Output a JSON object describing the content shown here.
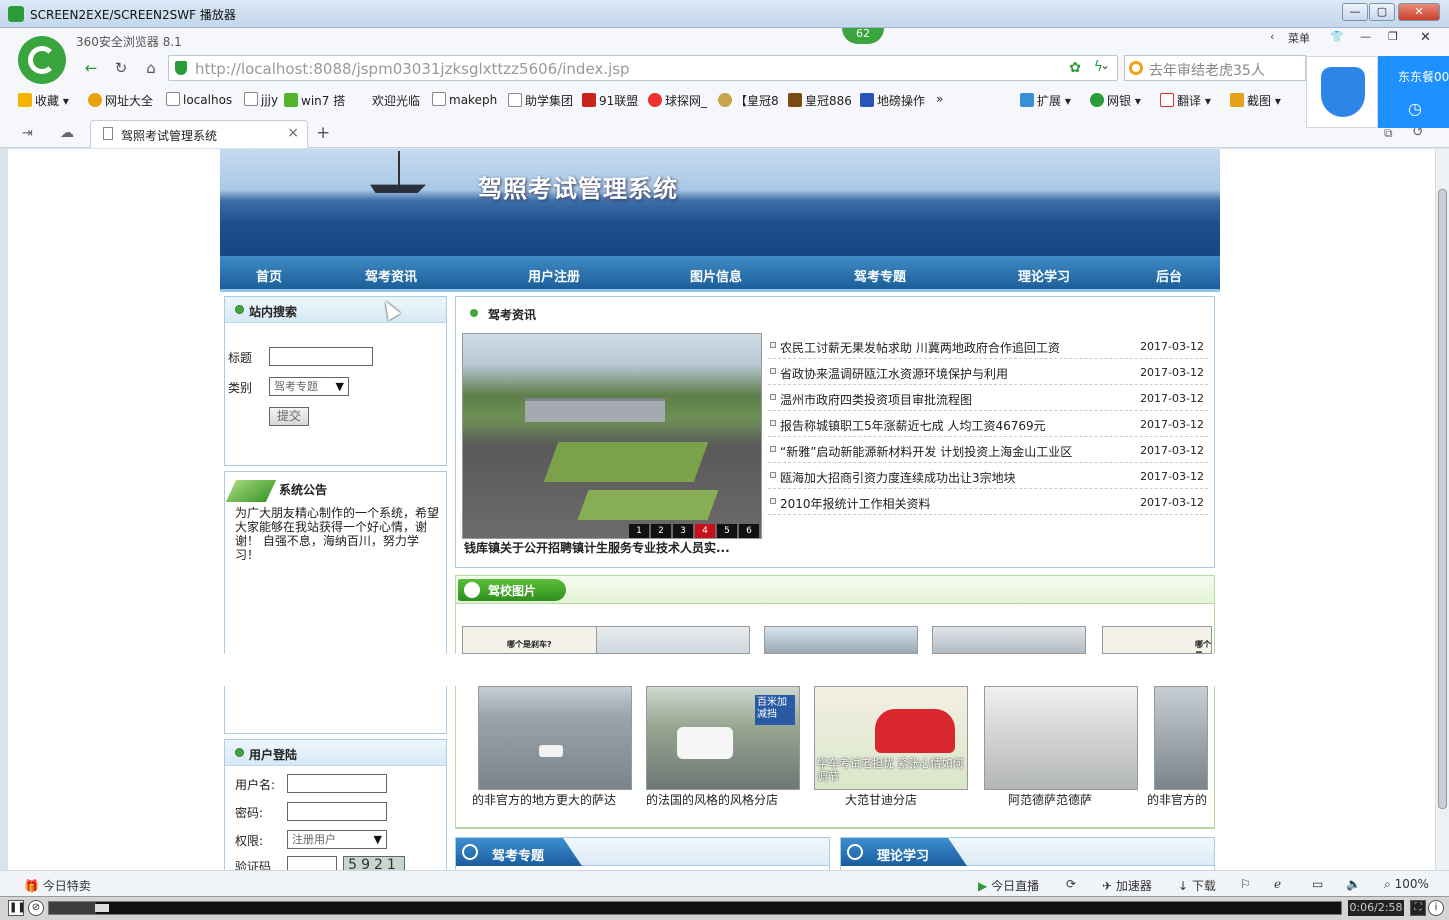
{
  "window": {
    "title": "SCREEN2EXE/SCREEN2SWF 播放器"
  },
  "browser": {
    "brand": "360安全浏览器 8.1",
    "badge": "62",
    "menu_label": "菜单",
    "url_host": "http://localhost",
    "url_rest": ":8088/jspm03031jzksglxttzz5606/index.jsp",
    "search_placeholder": "去年审结老虎35人",
    "bookmarks": [
      "收藏",
      "网址大全",
      "localhos",
      "jjjy",
      "win7 搭",
      "欢迎光临",
      "makeph",
      "助学集团",
      "91联盟",
      "球探网_",
      "【皇冠8",
      "皇冠886",
      "地磅操作"
    ],
    "toolbar_right": [
      "扩展",
      "网银",
      "翻译",
      "截图"
    ],
    "tab_title": "驾照考试管理系统",
    "side_widget_text": "东东餐00"
  },
  "site": {
    "title": "驾照考试管理系统",
    "nav": [
      "首页",
      "驾考资讯",
      "用户注册",
      "图片信息",
      "驾考专题",
      "理论学习",
      "后台"
    ],
    "search": {
      "heading": "站内搜索",
      "title_label": "标题",
      "category_label": "类别",
      "category_value": "驾考专题",
      "submit": "提交"
    },
    "notice": {
      "heading": "系统公告",
      "body": "为广大朋友精心制作的一个系统，希望大家能够在我站获得一个好心情，谢谢！ 自强不息，海纳百川，努力学习！"
    },
    "login": {
      "heading": "用户登陆",
      "username_label": "用户名:",
      "password_label": "密码:",
      "role_label": "权限:",
      "role_value": "注册用户",
      "captcha_label": "验证码",
      "captcha": "5921"
    },
    "news": {
      "heading": "驾考资讯",
      "caption": "钱库镇关于公开招聘镇计生服务专业技术人员实...",
      "pager": [
        "1",
        "2",
        "3",
        "4",
        "5",
        "6"
      ],
      "items": [
        {
          "title": "农民工讨薪无果发帖求助 川冀两地政府合作追回工资",
          "date": "2017-03-12"
        },
        {
          "title": "省政协来温调研瓯江水资源环境保护与利用",
          "date": "2017-03-12"
        },
        {
          "title": "温州市政府四类投资项目审批流程图",
          "date": "2017-03-12"
        },
        {
          "title": "报告称城镇职工5年涨薪近七成 人均工资46769元",
          "date": "2017-03-12"
        },
        {
          "title": "“新雅”启动新能源新材料开发 计划投资上海金山工业区",
          "date": "2017-03-12"
        },
        {
          "title": "瓯海加大招商引资力度连续成功出让3宗地块",
          "date": "2017-03-12"
        },
        {
          "title": "2010年报统计工作相关资料",
          "date": "2017-03-12"
        }
      ]
    },
    "pictures": {
      "heading": "驾校图片",
      "top_row_texts": [
        "哪个是刹车?",
        "哪个是"
      ],
      "captions": [
        "的非官方的地方更大的萨达",
        "的法国的风格的风格分店",
        "大范甘迪分店",
        "阿范德萨范德萨",
        "的非官方的"
      ],
      "sign_text": "百米加减挡",
      "poster_text": "学车考试老担忧 紧张心情如何调节"
    },
    "bottom_sections": [
      "驾考专题",
      "理论学习"
    ]
  },
  "statusbar": {
    "left": "今日特卖",
    "items": [
      "今日直播",
      "加速器",
      "下载"
    ],
    "zoom": "100%"
  },
  "player": {
    "time": "0:06/2:58",
    "progress_fraction": 0.036
  }
}
